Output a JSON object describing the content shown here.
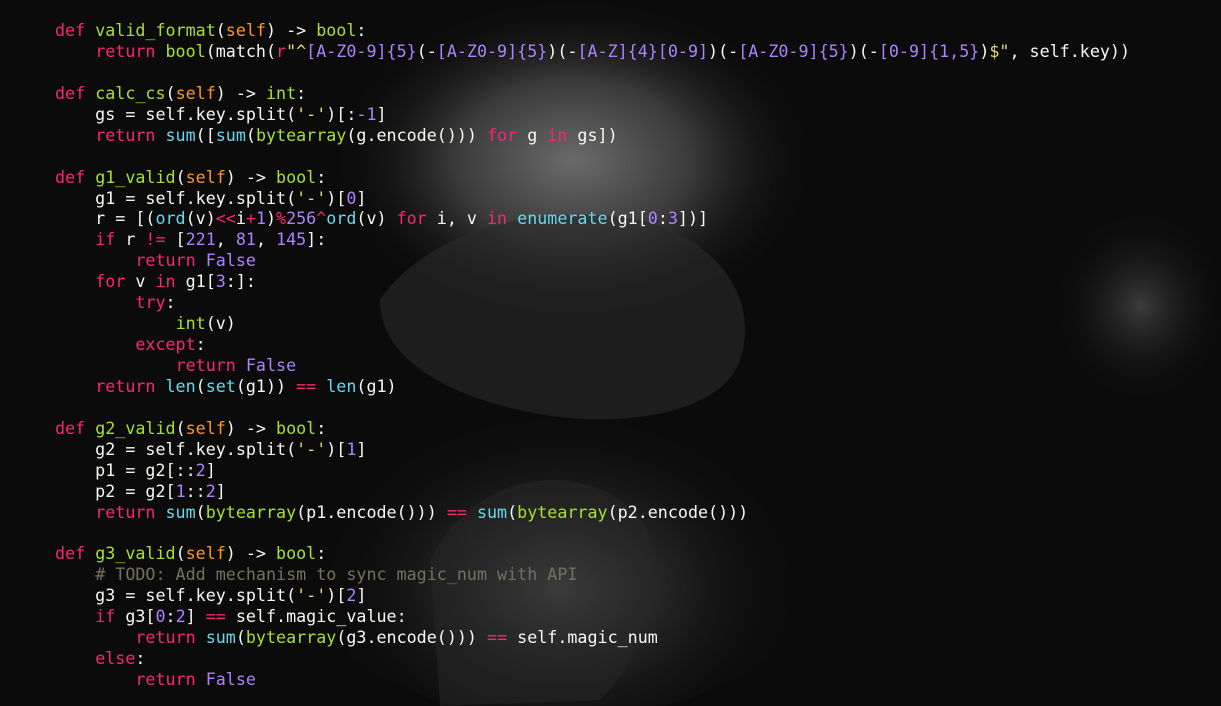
{
  "background": {
    "description_color": "#111111"
  },
  "lines": [
    [
      [
        "kw",
        "def"
      ],
      [
        "tx",
        " "
      ],
      [
        "fn",
        "valid_format"
      ],
      [
        "tx",
        "("
      ],
      [
        "self",
        "self"
      ],
      [
        "tx",
        ") -> "
      ],
      [
        "fn",
        "bool"
      ],
      [
        "tx",
        ":"
      ]
    ],
    [
      [
        "tx",
        "    "
      ],
      [
        "kw",
        "return"
      ],
      [
        "tx",
        " "
      ],
      [
        "fn",
        "bool"
      ],
      [
        "tx",
        "(match("
      ],
      [
        "kw",
        "r"
      ],
      [
        "str",
        "\"^"
      ],
      [
        "rx",
        "[A-Z0-9]"
      ],
      [
        "num",
        "{5}"
      ],
      [
        "tx",
        "(-"
      ],
      [
        "rx",
        "[A-Z0-9]"
      ],
      [
        "num",
        "{5}"
      ],
      [
        "tx",
        ")(-"
      ],
      [
        "rx",
        "[A-Z]"
      ],
      [
        "num",
        "{4}"
      ],
      [
        "rx",
        "[0-9]"
      ],
      [
        "tx",
        ")(-"
      ],
      [
        "rx",
        "[A-Z0-9]"
      ],
      [
        "num",
        "{5}"
      ],
      [
        "tx",
        ")(-"
      ],
      [
        "rx",
        "[0-9]"
      ],
      [
        "num",
        "{1,5}"
      ],
      [
        "tx",
        ")"
      ],
      [
        "str",
        "$\""
      ],
      [
        "tx",
        ", self.key))"
      ]
    ],
    [],
    [
      [
        "kw",
        "def"
      ],
      [
        "tx",
        " "
      ],
      [
        "fn",
        "calc_cs"
      ],
      [
        "tx",
        "("
      ],
      [
        "self",
        "self"
      ],
      [
        "tx",
        ") -> "
      ],
      [
        "fn",
        "int"
      ],
      [
        "tx",
        ":"
      ]
    ],
    [
      [
        "tx",
        "    gs = self.key.split("
      ],
      [
        "str",
        "'-'"
      ],
      [
        "tx",
        ")[:"
      ],
      [
        "num",
        "-1"
      ],
      [
        "tx",
        "]"
      ]
    ],
    [
      [
        "tx",
        "    "
      ],
      [
        "kw",
        "return"
      ],
      [
        "tx",
        " "
      ],
      [
        "bi",
        "sum"
      ],
      [
        "tx",
        "(["
      ],
      [
        "bi",
        "sum"
      ],
      [
        "tx",
        "("
      ],
      [
        "fn",
        "bytearray"
      ],
      [
        "tx",
        "(g.encode())) "
      ],
      [
        "kw",
        "for"
      ],
      [
        "tx",
        " g "
      ],
      [
        "kw",
        "in"
      ],
      [
        "tx",
        " gs])"
      ]
    ],
    [],
    [
      [
        "kw",
        "def"
      ],
      [
        "tx",
        " "
      ],
      [
        "fn",
        "g1_valid"
      ],
      [
        "tx",
        "("
      ],
      [
        "self",
        "self"
      ],
      [
        "tx",
        ") -> "
      ],
      [
        "fn",
        "bool"
      ],
      [
        "tx",
        ":"
      ]
    ],
    [
      [
        "tx",
        "    g1 = self.key.split("
      ],
      [
        "str",
        "'-'"
      ],
      [
        "tx",
        ")["
      ],
      [
        "num",
        "0"
      ],
      [
        "tx",
        "]"
      ]
    ],
    [
      [
        "tx",
        "    r = [("
      ],
      [
        "bi",
        "ord"
      ],
      [
        "tx",
        "(v)"
      ],
      [
        "op",
        "<<"
      ],
      [
        "tx",
        "i"
      ],
      [
        "op",
        "+"
      ],
      [
        "num",
        "1"
      ],
      [
        "tx",
        ")"
      ],
      [
        "op",
        "%"
      ],
      [
        "num",
        "256"
      ],
      [
        "op",
        "^"
      ],
      [
        "bi",
        "ord"
      ],
      [
        "tx",
        "(v) "
      ],
      [
        "kw",
        "for"
      ],
      [
        "tx",
        " i, v "
      ],
      [
        "kw",
        "in"
      ],
      [
        "tx",
        " "
      ],
      [
        "bi",
        "enumerate"
      ],
      [
        "tx",
        "(g1["
      ],
      [
        "num",
        "0"
      ],
      [
        "tx",
        ":"
      ],
      [
        "num",
        "3"
      ],
      [
        "tx",
        "])]"
      ]
    ],
    [
      [
        "tx",
        "    "
      ],
      [
        "kw",
        "if"
      ],
      [
        "tx",
        " r "
      ],
      [
        "op",
        "!="
      ],
      [
        "tx",
        " ["
      ],
      [
        "num",
        "221"
      ],
      [
        "tx",
        ", "
      ],
      [
        "num",
        "81"
      ],
      [
        "tx",
        ", "
      ],
      [
        "num",
        "145"
      ],
      [
        "tx",
        "]:"
      ]
    ],
    [
      [
        "tx",
        "        "
      ],
      [
        "kw",
        "return"
      ],
      [
        "tx",
        " "
      ],
      [
        "num",
        "False"
      ]
    ],
    [
      [
        "tx",
        "    "
      ],
      [
        "kw",
        "for"
      ],
      [
        "tx",
        " v "
      ],
      [
        "kw",
        "in"
      ],
      [
        "tx",
        " g1["
      ],
      [
        "num",
        "3"
      ],
      [
        "tx",
        ":]:"
      ]
    ],
    [
      [
        "tx",
        "        "
      ],
      [
        "kw",
        "try"
      ],
      [
        "tx",
        ":"
      ]
    ],
    [
      [
        "tx",
        "            "
      ],
      [
        "fn",
        "int"
      ],
      [
        "tx",
        "(v)"
      ]
    ],
    [
      [
        "tx",
        "        "
      ],
      [
        "kw",
        "except"
      ],
      [
        "tx",
        ":"
      ]
    ],
    [
      [
        "tx",
        "            "
      ],
      [
        "kw",
        "return"
      ],
      [
        "tx",
        " "
      ],
      [
        "num",
        "False"
      ]
    ],
    [
      [
        "tx",
        "    "
      ],
      [
        "kw",
        "return"
      ],
      [
        "tx",
        " "
      ],
      [
        "bi",
        "len"
      ],
      [
        "tx",
        "("
      ],
      [
        "bi",
        "set"
      ],
      [
        "tx",
        "(g1)) "
      ],
      [
        "op",
        "=="
      ],
      [
        "tx",
        " "
      ],
      [
        "bi",
        "len"
      ],
      [
        "tx",
        "(g1)"
      ]
    ],
    [],
    [
      [
        "kw",
        "def"
      ],
      [
        "tx",
        " "
      ],
      [
        "fn",
        "g2_valid"
      ],
      [
        "tx",
        "("
      ],
      [
        "self",
        "self"
      ],
      [
        "tx",
        ") -> "
      ],
      [
        "fn",
        "bool"
      ],
      [
        "tx",
        ":"
      ]
    ],
    [
      [
        "tx",
        "    g2 = self.key.split("
      ],
      [
        "str",
        "'-'"
      ],
      [
        "tx",
        ")["
      ],
      [
        "num",
        "1"
      ],
      [
        "tx",
        "]"
      ]
    ],
    [
      [
        "tx",
        "    p1 = g2[::"
      ],
      [
        "num",
        "2"
      ],
      [
        "tx",
        "]"
      ]
    ],
    [
      [
        "tx",
        "    p2 = g2["
      ],
      [
        "num",
        "1"
      ],
      [
        "tx",
        "::"
      ],
      [
        "num",
        "2"
      ],
      [
        "tx",
        "]"
      ]
    ],
    [
      [
        "tx",
        "    "
      ],
      [
        "kw",
        "return"
      ],
      [
        "tx",
        " "
      ],
      [
        "bi",
        "sum"
      ],
      [
        "tx",
        "("
      ],
      [
        "fn",
        "bytearray"
      ],
      [
        "tx",
        "(p1.encode())) "
      ],
      [
        "op",
        "=="
      ],
      [
        "tx",
        " "
      ],
      [
        "bi",
        "sum"
      ],
      [
        "tx",
        "("
      ],
      [
        "fn",
        "bytearray"
      ],
      [
        "tx",
        "(p2.encode()))"
      ]
    ],
    [],
    [
      [
        "kw",
        "def"
      ],
      [
        "tx",
        " "
      ],
      [
        "fn",
        "g3_valid"
      ],
      [
        "tx",
        "("
      ],
      [
        "self",
        "self"
      ],
      [
        "tx",
        ") -> "
      ],
      [
        "fn",
        "bool"
      ],
      [
        "tx",
        ":"
      ]
    ],
    [
      [
        "tx",
        "    "
      ],
      [
        "cm",
        "# TODO: Add mechanism to sync magic_num with API"
      ]
    ],
    [
      [
        "tx",
        "    g3 = self.key.split("
      ],
      [
        "str",
        "'-'"
      ],
      [
        "tx",
        ")["
      ],
      [
        "num",
        "2"
      ],
      [
        "tx",
        "]"
      ]
    ],
    [
      [
        "tx",
        "    "
      ],
      [
        "kw",
        "if"
      ],
      [
        "tx",
        " g3["
      ],
      [
        "num",
        "0"
      ],
      [
        "tx",
        ":"
      ],
      [
        "num",
        "2"
      ],
      [
        "tx",
        "] "
      ],
      [
        "op",
        "=="
      ],
      [
        "tx",
        " self.magic_value:"
      ]
    ],
    [
      [
        "tx",
        "        "
      ],
      [
        "kw",
        "return"
      ],
      [
        "tx",
        " "
      ],
      [
        "bi",
        "sum"
      ],
      [
        "tx",
        "("
      ],
      [
        "fn",
        "bytearray"
      ],
      [
        "tx",
        "(g3.encode())) "
      ],
      [
        "op",
        "=="
      ],
      [
        "tx",
        " self.magic_num"
      ]
    ],
    [
      [
        "tx",
        "    "
      ],
      [
        "kw",
        "else"
      ],
      [
        "tx",
        ":"
      ]
    ],
    [
      [
        "tx",
        "        "
      ],
      [
        "kw",
        "return"
      ],
      [
        "tx",
        " "
      ],
      [
        "num",
        "False"
      ]
    ]
  ]
}
